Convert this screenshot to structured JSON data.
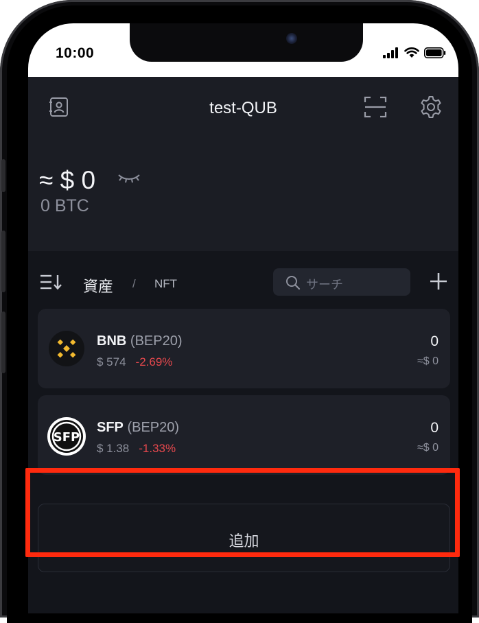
{
  "status_bar": {
    "time": "10:00"
  },
  "header": {
    "wallet_name": "test-QUB"
  },
  "balance": {
    "fiat": "≈ $ 0",
    "btc": "0 BTC"
  },
  "tabs": {
    "assets": "資産",
    "separator": "/",
    "nft": "NFT"
  },
  "search": {
    "placeholder": "サーチ"
  },
  "tokens": [
    {
      "symbol": "BNB",
      "standard": "(BEP20)",
      "price": "$ 574",
      "change": "-2.69%",
      "amount": "0",
      "fiat": "≈$ 0",
      "logo": "bnb-logo"
    },
    {
      "symbol": "SFP",
      "standard": "(BEP20)",
      "price": "$ 1.38",
      "change": "-1.33%",
      "amount": "0",
      "fiat": "≈$ 0",
      "logo": "sfp-logo"
    }
  ],
  "add_button": {
    "label": "追加"
  },
  "colors": {
    "negative": "#e5484d",
    "highlight": "#ff2a0e",
    "bnb": "#f3ba2f"
  }
}
